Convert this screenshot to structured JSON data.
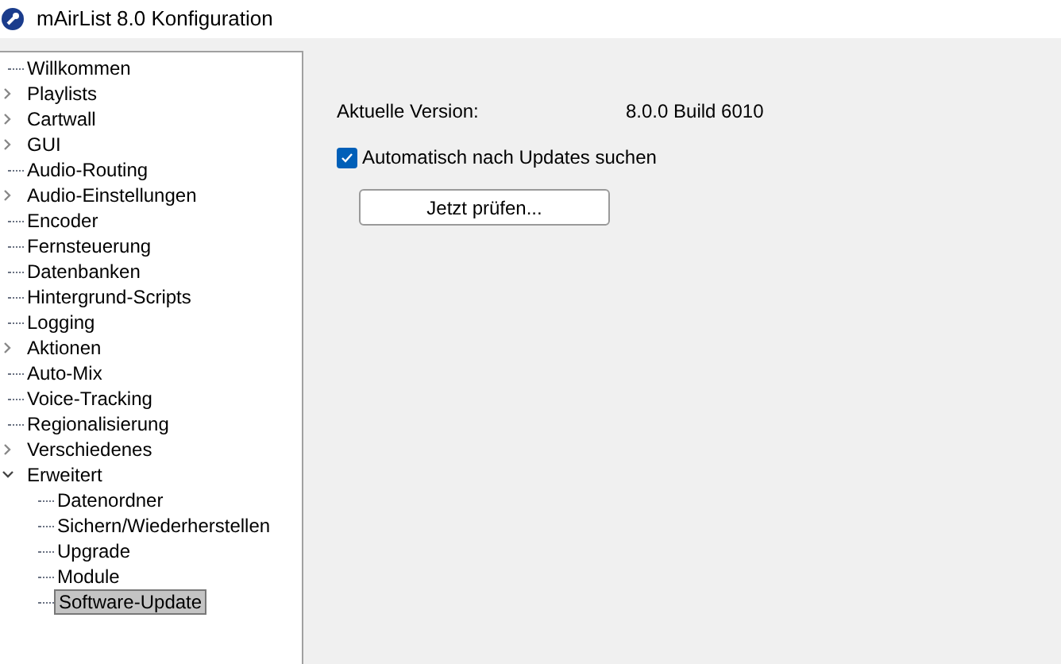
{
  "window": {
    "title": "mAirList 8.0 Konfiguration"
  },
  "tree": [
    {
      "label": "Willkommen",
      "selected": false
    },
    {
      "label": "Playlists",
      "selected": false,
      "expanded": false
    },
    {
      "label": "Cartwall",
      "selected": false,
      "expanded": false
    },
    {
      "label": "GUI",
      "selected": false,
      "expanded": false
    },
    {
      "label": "Audio-Routing",
      "selected": false
    },
    {
      "label": "Audio-Einstellungen",
      "selected": false,
      "expanded": false
    },
    {
      "label": "Encoder",
      "selected": false
    },
    {
      "label": "Fernsteuerung",
      "selected": false
    },
    {
      "label": "Datenbanken",
      "selected": false
    },
    {
      "label": "Hintergrund-Scripts",
      "selected": false
    },
    {
      "label": "Logging",
      "selected": false
    },
    {
      "label": "Aktionen",
      "selected": false,
      "expanded": false
    },
    {
      "label": "Auto-Mix",
      "selected": false
    },
    {
      "label": "Voice-Tracking",
      "selected": false
    },
    {
      "label": "Regionalisierung",
      "selected": false
    },
    {
      "label": "Verschiedenes",
      "selected": false,
      "expanded": false
    },
    {
      "label": "Erweitert",
      "selected": false,
      "expanded": true,
      "children": [
        {
          "label": "Datenordner",
          "selected": false
        },
        {
          "label": "Sichern/Wiederherstellen",
          "selected": false
        },
        {
          "label": "Upgrade",
          "selected": false
        },
        {
          "label": "Module",
          "selected": false
        },
        {
          "label": "Software-Update",
          "selected": true
        }
      ]
    }
  ],
  "panel": {
    "version_label": "Aktuelle Version:",
    "version_value": "8.0.0 Build 6010",
    "auto_update": {
      "label": "Automatisch nach Updates suchen",
      "checked": true
    },
    "check_button": "Jetzt prüfen..."
  }
}
